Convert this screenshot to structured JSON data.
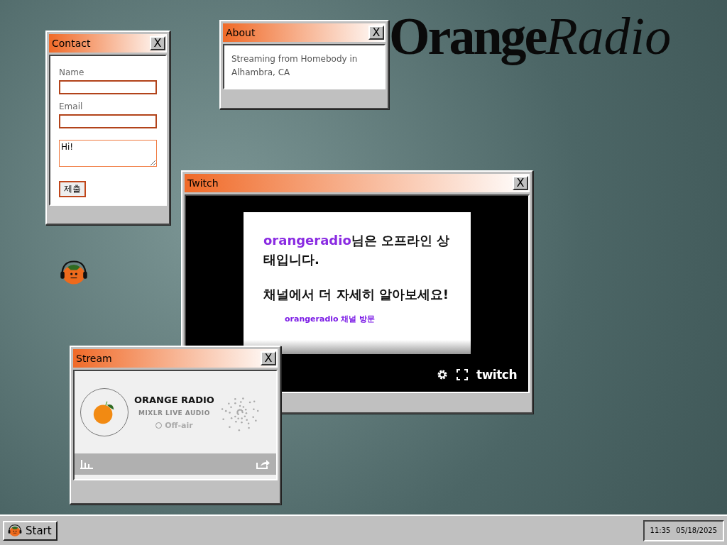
{
  "brand": {
    "word_1": "Orange",
    "word_2": "Radio"
  },
  "windows": [
    {
      "kind": "contact",
      "title": "Contact",
      "close": "X",
      "fields": [
        {
          "label": "Name"
        },
        {
          "label": "Email"
        }
      ],
      "message": "Hi!",
      "submit": "제출"
    },
    {
      "kind": "about",
      "title": "About",
      "close": "X",
      "text": "Streaming from Homebody in Alhambra, CA"
    },
    {
      "kind": "twitch",
      "title": "Twitch",
      "close": "X",
      "channel": "orangeradio",
      "offline_text": "님은 오프라인 상태입니다.",
      "more_text": "채널에서 더 자세히 알아보세요!",
      "link": "orangeradio 채널 방문",
      "logo": "twitch"
    },
    {
      "kind": "stream",
      "title": "Stream",
      "close": "X",
      "station": "ORANGE RADIO",
      "subtitle": "MIXLR LIVE AUDIO",
      "status": "Off-air",
      "live": false
    }
  ],
  "taskbar": {
    "start": "Start",
    "time": "11:35",
    "date": "05/18/2025"
  }
}
